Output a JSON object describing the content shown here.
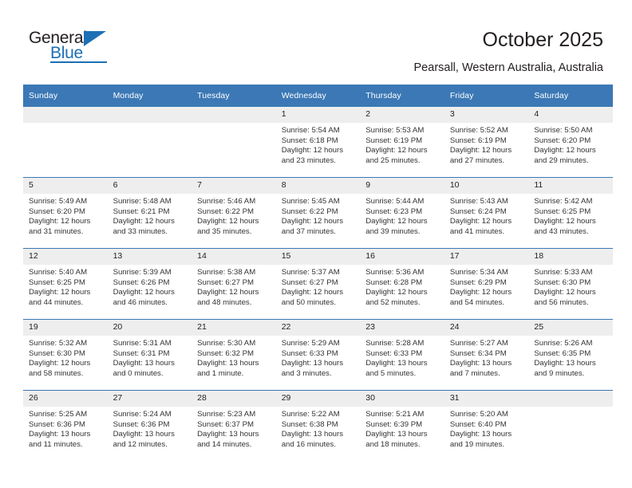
{
  "logo": {
    "word_top": "General",
    "word_bottom": "Blue",
    "triangle_icon": "blue-triangle-icon",
    "brand_color": "#1c6fb5"
  },
  "header": {
    "title": "October 2025",
    "location": "Pearsall, Western Australia, Australia"
  },
  "colors": {
    "header_blue": "#3b78b5",
    "daynum_band": "#eeeeee",
    "text": "#231f20"
  },
  "weekday_headers": [
    "Sunday",
    "Monday",
    "Tuesday",
    "Wednesday",
    "Thursday",
    "Friday",
    "Saturday"
  ],
  "weeks": [
    {
      "days": [
        {
          "num": "",
          "empty": true,
          "sunrise": "",
          "sunset": "",
          "daylight1": "",
          "daylight2": ""
        },
        {
          "num": "",
          "empty": true,
          "sunrise": "",
          "sunset": "",
          "daylight1": "",
          "daylight2": ""
        },
        {
          "num": "",
          "empty": true,
          "sunrise": "",
          "sunset": "",
          "daylight1": "",
          "daylight2": ""
        },
        {
          "num": "1",
          "empty": false,
          "sunrise": "Sunrise: 5:54 AM",
          "sunset": "Sunset: 6:18 PM",
          "daylight1": "Daylight: 12 hours",
          "daylight2": "and 23 minutes."
        },
        {
          "num": "2",
          "empty": false,
          "sunrise": "Sunrise: 5:53 AM",
          "sunset": "Sunset: 6:19 PM",
          "daylight1": "Daylight: 12 hours",
          "daylight2": "and 25 minutes."
        },
        {
          "num": "3",
          "empty": false,
          "sunrise": "Sunrise: 5:52 AM",
          "sunset": "Sunset: 6:19 PM",
          "daylight1": "Daylight: 12 hours",
          "daylight2": "and 27 minutes."
        },
        {
          "num": "4",
          "empty": false,
          "sunrise": "Sunrise: 5:50 AM",
          "sunset": "Sunset: 6:20 PM",
          "daylight1": "Daylight: 12 hours",
          "daylight2": "and 29 minutes."
        }
      ]
    },
    {
      "days": [
        {
          "num": "5",
          "empty": false,
          "sunrise": "Sunrise: 5:49 AM",
          "sunset": "Sunset: 6:20 PM",
          "daylight1": "Daylight: 12 hours",
          "daylight2": "and 31 minutes."
        },
        {
          "num": "6",
          "empty": false,
          "sunrise": "Sunrise: 5:48 AM",
          "sunset": "Sunset: 6:21 PM",
          "daylight1": "Daylight: 12 hours",
          "daylight2": "and 33 minutes."
        },
        {
          "num": "7",
          "empty": false,
          "sunrise": "Sunrise: 5:46 AM",
          "sunset": "Sunset: 6:22 PM",
          "daylight1": "Daylight: 12 hours",
          "daylight2": "and 35 minutes."
        },
        {
          "num": "8",
          "empty": false,
          "sunrise": "Sunrise: 5:45 AM",
          "sunset": "Sunset: 6:22 PM",
          "daylight1": "Daylight: 12 hours",
          "daylight2": "and 37 minutes."
        },
        {
          "num": "9",
          "empty": false,
          "sunrise": "Sunrise: 5:44 AM",
          "sunset": "Sunset: 6:23 PM",
          "daylight1": "Daylight: 12 hours",
          "daylight2": "and 39 minutes."
        },
        {
          "num": "10",
          "empty": false,
          "sunrise": "Sunrise: 5:43 AM",
          "sunset": "Sunset: 6:24 PM",
          "daylight1": "Daylight: 12 hours",
          "daylight2": "and 41 minutes."
        },
        {
          "num": "11",
          "empty": false,
          "sunrise": "Sunrise: 5:42 AM",
          "sunset": "Sunset: 6:25 PM",
          "daylight1": "Daylight: 12 hours",
          "daylight2": "and 43 minutes."
        }
      ]
    },
    {
      "days": [
        {
          "num": "12",
          "empty": false,
          "sunrise": "Sunrise: 5:40 AM",
          "sunset": "Sunset: 6:25 PM",
          "daylight1": "Daylight: 12 hours",
          "daylight2": "and 44 minutes."
        },
        {
          "num": "13",
          "empty": false,
          "sunrise": "Sunrise: 5:39 AM",
          "sunset": "Sunset: 6:26 PM",
          "daylight1": "Daylight: 12 hours",
          "daylight2": "and 46 minutes."
        },
        {
          "num": "14",
          "empty": false,
          "sunrise": "Sunrise: 5:38 AM",
          "sunset": "Sunset: 6:27 PM",
          "daylight1": "Daylight: 12 hours",
          "daylight2": "and 48 minutes."
        },
        {
          "num": "15",
          "empty": false,
          "sunrise": "Sunrise: 5:37 AM",
          "sunset": "Sunset: 6:27 PM",
          "daylight1": "Daylight: 12 hours",
          "daylight2": "and 50 minutes."
        },
        {
          "num": "16",
          "empty": false,
          "sunrise": "Sunrise: 5:36 AM",
          "sunset": "Sunset: 6:28 PM",
          "daylight1": "Daylight: 12 hours",
          "daylight2": "and 52 minutes."
        },
        {
          "num": "17",
          "empty": false,
          "sunrise": "Sunrise: 5:34 AM",
          "sunset": "Sunset: 6:29 PM",
          "daylight1": "Daylight: 12 hours",
          "daylight2": "and 54 minutes."
        },
        {
          "num": "18",
          "empty": false,
          "sunrise": "Sunrise: 5:33 AM",
          "sunset": "Sunset: 6:30 PM",
          "daylight1": "Daylight: 12 hours",
          "daylight2": "and 56 minutes."
        }
      ]
    },
    {
      "days": [
        {
          "num": "19",
          "empty": false,
          "sunrise": "Sunrise: 5:32 AM",
          "sunset": "Sunset: 6:30 PM",
          "daylight1": "Daylight: 12 hours",
          "daylight2": "and 58 minutes."
        },
        {
          "num": "20",
          "empty": false,
          "sunrise": "Sunrise: 5:31 AM",
          "sunset": "Sunset: 6:31 PM",
          "daylight1": "Daylight: 13 hours",
          "daylight2": "and 0 minutes."
        },
        {
          "num": "21",
          "empty": false,
          "sunrise": "Sunrise: 5:30 AM",
          "sunset": "Sunset: 6:32 PM",
          "daylight1": "Daylight: 13 hours",
          "daylight2": "and 1 minute."
        },
        {
          "num": "22",
          "empty": false,
          "sunrise": "Sunrise: 5:29 AM",
          "sunset": "Sunset: 6:33 PM",
          "daylight1": "Daylight: 13 hours",
          "daylight2": "and 3 minutes."
        },
        {
          "num": "23",
          "empty": false,
          "sunrise": "Sunrise: 5:28 AM",
          "sunset": "Sunset: 6:33 PM",
          "daylight1": "Daylight: 13 hours",
          "daylight2": "and 5 minutes."
        },
        {
          "num": "24",
          "empty": false,
          "sunrise": "Sunrise: 5:27 AM",
          "sunset": "Sunset: 6:34 PM",
          "daylight1": "Daylight: 13 hours",
          "daylight2": "and 7 minutes."
        },
        {
          "num": "25",
          "empty": false,
          "sunrise": "Sunrise: 5:26 AM",
          "sunset": "Sunset: 6:35 PM",
          "daylight1": "Daylight: 13 hours",
          "daylight2": "and 9 minutes."
        }
      ]
    },
    {
      "days": [
        {
          "num": "26",
          "empty": false,
          "sunrise": "Sunrise: 5:25 AM",
          "sunset": "Sunset: 6:36 PM",
          "daylight1": "Daylight: 13 hours",
          "daylight2": "and 11 minutes."
        },
        {
          "num": "27",
          "empty": false,
          "sunrise": "Sunrise: 5:24 AM",
          "sunset": "Sunset: 6:36 PM",
          "daylight1": "Daylight: 13 hours",
          "daylight2": "and 12 minutes."
        },
        {
          "num": "28",
          "empty": false,
          "sunrise": "Sunrise: 5:23 AM",
          "sunset": "Sunset: 6:37 PM",
          "daylight1": "Daylight: 13 hours",
          "daylight2": "and 14 minutes."
        },
        {
          "num": "29",
          "empty": false,
          "sunrise": "Sunrise: 5:22 AM",
          "sunset": "Sunset: 6:38 PM",
          "daylight1": "Daylight: 13 hours",
          "daylight2": "and 16 minutes."
        },
        {
          "num": "30",
          "empty": false,
          "sunrise": "Sunrise: 5:21 AM",
          "sunset": "Sunset: 6:39 PM",
          "daylight1": "Daylight: 13 hours",
          "daylight2": "and 18 minutes."
        },
        {
          "num": "31",
          "empty": false,
          "sunrise": "Sunrise: 5:20 AM",
          "sunset": "Sunset: 6:40 PM",
          "daylight1": "Daylight: 13 hours",
          "daylight2": "and 19 minutes."
        },
        {
          "num": "",
          "empty": true,
          "sunrise": "",
          "sunset": "",
          "daylight1": "",
          "daylight2": ""
        }
      ]
    }
  ]
}
